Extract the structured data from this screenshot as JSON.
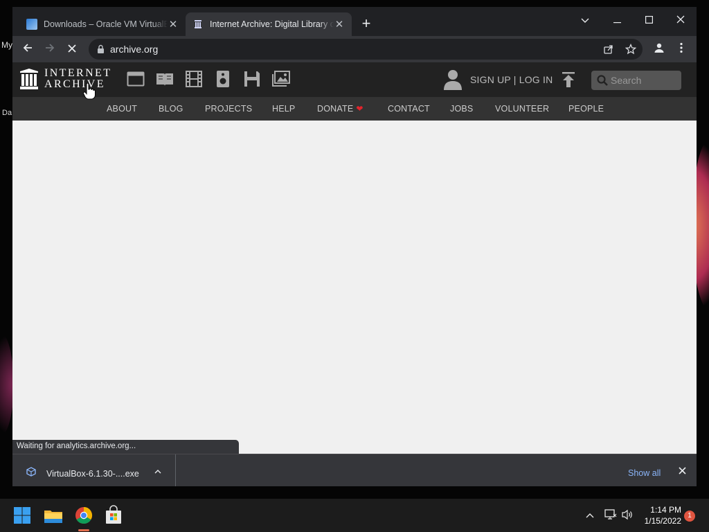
{
  "desktop": {
    "labels": [
      "My",
      "Da"
    ]
  },
  "browser": {
    "tabs": [
      {
        "title": "Downloads – Oracle VM VirtualBox",
        "active": false
      },
      {
        "title": "Internet Archive: Digital Library of Free & Borrowable Books",
        "active": true
      }
    ],
    "address": "archive.org",
    "status": "Waiting for analytics.archive.org..."
  },
  "ia": {
    "logo_line1": "INTERNET",
    "logo_line2": "ARCHIVE",
    "signup": "SIGN UP | LOG IN",
    "search_placeholder": "Search",
    "nav": [
      "ABOUT",
      "BLOG",
      "PROJECTS",
      "HELP",
      "DONATE",
      "CONTACT",
      "JOBS",
      "VOLUNTEER",
      "PEOPLE"
    ]
  },
  "downloads": {
    "file": "VirtualBox-6.1.30-....exe",
    "show_all": "Show all"
  },
  "taskbar": {
    "time": "1:14 PM",
    "date": "1/15/2022",
    "notification_count": "1"
  },
  "colors": {
    "accent_link": "#8ab4f8",
    "donate_heart": "#e2242c",
    "ia_header": "#222222",
    "ia_nav": "#333333"
  }
}
